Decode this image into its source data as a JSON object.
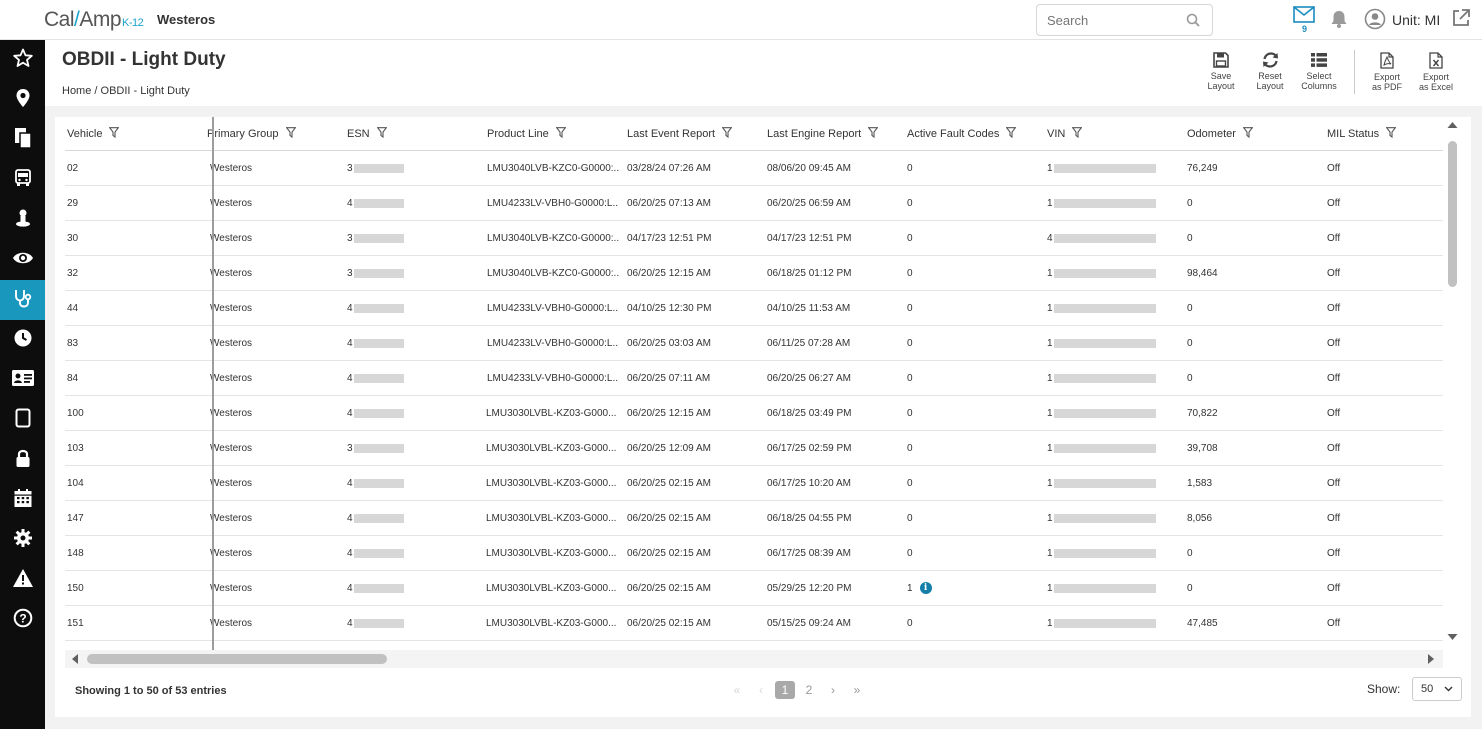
{
  "app": {
    "logo": {
      "part1": "Cal",
      "slash": "/",
      "part2": "Amp",
      "sub": "K-12"
    },
    "tenant": "Westeros",
    "search_placeholder": "Search",
    "mail_count": "9",
    "unit_label": "Unit: MI"
  },
  "page": {
    "title": "OBDII - Light Duty",
    "breadcrumb": "Home / OBDII - Light Duty"
  },
  "toolbar": {
    "save": [
      "Save",
      "Layout"
    ],
    "reset": [
      "Reset",
      "Layout"
    ],
    "select": [
      "Select",
      "Columns"
    ],
    "pdf": [
      "Export",
      "as PDF"
    ],
    "excel": [
      "Export",
      "as Excel"
    ]
  },
  "sidebar": [
    "star-icon",
    "map-marker-icon",
    "documents-icon",
    "bus-icon",
    "driver-icon",
    "eye-icon",
    "stethoscope-icon",
    "clock-icon",
    "id-card-icon",
    "tablet-icon",
    "lock-icon",
    "calendar-icon",
    "gear-icon",
    "warning-icon",
    "help-icon"
  ],
  "sidebar_active_index": 6,
  "colors": {
    "accent": "#1a97bd",
    "sidebar": "#0d0d0d",
    "info": "#137fa8"
  },
  "table": {
    "columns": [
      "Vehicle",
      "Primary Group",
      "ESN",
      "Product Line",
      "Last Event Report",
      "Last Engine Report",
      "Active Fault Codes",
      "VIN",
      "Odometer",
      "MIL Status"
    ],
    "rows": [
      {
        "vehicle": "02",
        "group": "Westeros",
        "esn": "3",
        "product": "LMU3040LVB-KZC0-G0000:...",
        "event": "03/28/24 07:26 AM",
        "engine": "08/06/20 09:45 AM",
        "faults": "0",
        "vin": "1",
        "odometer": "76,249",
        "mil": "Off"
      },
      {
        "vehicle": "29",
        "group": "Westeros",
        "esn": "4",
        "product": "LMU4233LV-VBH0-G0000:L...",
        "event": "06/20/25 07:13 AM",
        "engine": "06/20/25 06:59 AM",
        "faults": "0",
        "vin": "1",
        "odometer": "0",
        "mil": "Off"
      },
      {
        "vehicle": "30",
        "group": "Westeros",
        "esn": "3",
        "product": "LMU3040LVB-KZC0-G0000:...",
        "event": "04/17/23 12:51 PM",
        "engine": "04/17/23 12:51 PM",
        "faults": "0",
        "vin": "4",
        "odometer": "0",
        "mil": "Off"
      },
      {
        "vehicle": "32",
        "group": "Westeros",
        "esn": "3",
        "product": "LMU3040LVB-KZC0-G0000:...",
        "event": "06/20/25 12:15 AM",
        "engine": "06/18/25 01:12 PM",
        "faults": "0",
        "vin": "1",
        "odometer": "98,464",
        "mil": "Off"
      },
      {
        "vehicle": "44",
        "group": "Westeros",
        "esn": "4",
        "product": "LMU4233LV-VBH0-G0000:L...",
        "event": "04/10/25 12:30 PM",
        "engine": "04/10/25 11:53 AM",
        "faults": "0",
        "vin": "1",
        "odometer": "0",
        "mil": "Off"
      },
      {
        "vehicle": "83",
        "group": "Westeros",
        "esn": "4",
        "product": "LMU4233LV-VBH0-G0000:L...",
        "event": "06/20/25 03:03 AM",
        "engine": "06/11/25 07:28 AM",
        "faults": "0",
        "vin": "1",
        "odometer": "0",
        "mil": "Off"
      },
      {
        "vehicle": "84",
        "group": "Westeros",
        "esn": "4",
        "product": "LMU4233LV-VBH0-G0000:L...",
        "event": "06/20/25 07:11 AM",
        "engine": "06/20/25 06:27 AM",
        "faults": "0",
        "vin": "1",
        "odometer": "0",
        "mil": "Off"
      },
      {
        "vehicle": "100",
        "group": "Westeros",
        "esn": "4",
        "product": "LMU3030LVBL-KZ03-G000...",
        "event": "06/20/25 12:15 AM",
        "engine": "06/18/25 03:49 PM",
        "faults": "0",
        "vin": "1",
        "odometer": "70,822",
        "mil": "Off"
      },
      {
        "vehicle": "103",
        "group": "Westeros",
        "esn": "3",
        "product": "LMU3030LVBL-KZ03-G000...",
        "event": "06/20/25 12:09 AM",
        "engine": "06/17/25 02:59 PM",
        "faults": "0",
        "vin": "1",
        "odometer": "39,708",
        "mil": "Off"
      },
      {
        "vehicle": "104",
        "group": "Westeros",
        "esn": "4",
        "product": "LMU3030LVBL-KZ03-G000...",
        "event": "06/20/25 02:15 AM",
        "engine": "06/17/25 10:20 AM",
        "faults": "0",
        "vin": "1",
        "odometer": "1,583",
        "mil": "Off"
      },
      {
        "vehicle": "147",
        "group": "Westeros",
        "esn": "4",
        "product": "LMU3030LVBL-KZ03-G000...",
        "event": "06/20/25 02:15 AM",
        "engine": "06/18/25 04:55 PM",
        "faults": "0",
        "vin": "1",
        "odometer": "8,056",
        "mil": "Off"
      },
      {
        "vehicle": "148",
        "group": "Westeros",
        "esn": "4",
        "product": "LMU3030LVBL-KZ03-G000...",
        "event": "06/20/25 02:15 AM",
        "engine": "06/17/25 08:39 AM",
        "faults": "0",
        "vin": "1",
        "odometer": "0",
        "mil": "Off"
      },
      {
        "vehicle": "150",
        "group": "Westeros",
        "esn": "4",
        "product": "LMU3030LVBL-KZ03-G000...",
        "event": "06/20/25 02:15 AM",
        "engine": "05/29/25 12:20 PM",
        "faults": "1",
        "vin": "1",
        "odometer": "0",
        "mil": "Off",
        "fault_info": true
      },
      {
        "vehicle": "151",
        "group": "Westeros",
        "esn": "4",
        "product": "LMU3030LVBL-KZ03-G000...",
        "event": "06/20/25 02:15 AM",
        "engine": "05/15/25 09:24 AM",
        "faults": "0",
        "vin": "1",
        "odometer": "47,485",
        "mil": "Off"
      }
    ]
  },
  "footer": {
    "showing": "Showing 1 to 50 of 53 entries",
    "pages": [
      "1",
      "2"
    ],
    "current_page": "1",
    "nav": {
      "first": "«",
      "prev": "‹",
      "next": "›",
      "last": "»"
    },
    "show_label": "Show:",
    "page_size": "50"
  }
}
